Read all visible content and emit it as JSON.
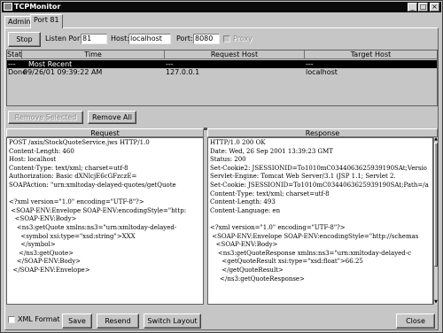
{
  "window": {
    "title": "TCPMonitor",
    "controls": {
      "minimize": "_",
      "maximize": "□",
      "close": "×"
    }
  },
  "tabs": [
    {
      "label": "Admin"
    },
    {
      "label": "Port 81"
    }
  ],
  "controls_bar": {
    "stop_label": "Stop",
    "listen_port_label": "Listen Port:",
    "listen_port_value": "81",
    "host_label": "Host:",
    "host_value": "localhost",
    "port_label": "Port:",
    "port_value": "8080",
    "proxy_label": "Proxy"
  },
  "table": {
    "columns": [
      "State",
      "Time",
      "Request Host",
      "Target Host"
    ],
    "rows": [
      {
        "state": "---",
        "time": "Most Recent",
        "request_host": "---",
        "target_host": "---"
      },
      {
        "state": "Done",
        "time": "09/26/01 09:39:22 AM",
        "request_host": "127.0.0.1",
        "target_host": "localhost"
      }
    ]
  },
  "table_buttons": {
    "remove_selected": "Remove Selected",
    "remove_all": "Remove All"
  },
  "request": {
    "header": "Request",
    "lines": [
      "POST /axis/StockQuoteService.jws HTTP/1.0",
      "Content-Length: 460",
      "Host: localhost",
      "Content-Type: text/xml; charset=utf-8",
      "Authorization: Basic dXNlcjE6cGFzczE=",
      "SOAPAction: \"urn:xmltoday-delayed-quotes/getQuote",
      "",
      "<?xml version=\"1.0\" encoding=\"UTF-8\"?>",
      " <SOAP-ENV:Envelope SOAP-ENV:encodingStyle=\"http:",
      "   <SOAP-ENV:Body>",
      "    <ns3:getQuote xmlns:ns3=\"urn:xmltoday-delayed-",
      "      <symbol xsi:type=\"xsd:string\">XXX",
      "      </symbol>",
      "     </ns3:getQuote>",
      "    </SOAP-ENV:Body>",
      "  </SOAP-ENV:Envelope>"
    ]
  },
  "response": {
    "header": "Response",
    "lines": [
      "HTTP/1.0 200 OK",
      "Date: Wed, 26 Sep 2001 13:39:23 GMT",
      "Status: 200",
      "Set-Cookie2: JSESSIONID=To1010mC0344063625939190SAt;Versio",
      "Servlet-Engine: Tomcat Web Server/3.1 (JSP 1.1; Servlet 2.",
      "Set-Cookie: JSESSIONID=To1010mC0344063625939190SAt;Path=/a",
      "Content-Type: text/xml; charset=utf-8",
      "Content-Length: 493",
      "Content-Language: en",
      "",
      "<?xml version=\"1.0\" encoding=\"UTF-8\"?>",
      " <SOAP-ENV:Envelope SOAP-ENV:encodingStyle=\"http://schemas",
      "   <SOAP-ENV:Body>",
      "    <ns3:getQuoteResponse xmlns:ns3=\"urn:xmltoday-delayed-c",
      "      <getQuoteResult xsi:type=\"xsd:float\">66.25",
      "      </getQuoteResult>",
      "     </ns3:getQuoteResponse>"
    ]
  },
  "bottom_bar": {
    "xml_format_label": "XML Format",
    "save_label": "Save",
    "resend_label": "Resend",
    "switch_layout_label": "Switch Layout",
    "close_label": "Close"
  }
}
